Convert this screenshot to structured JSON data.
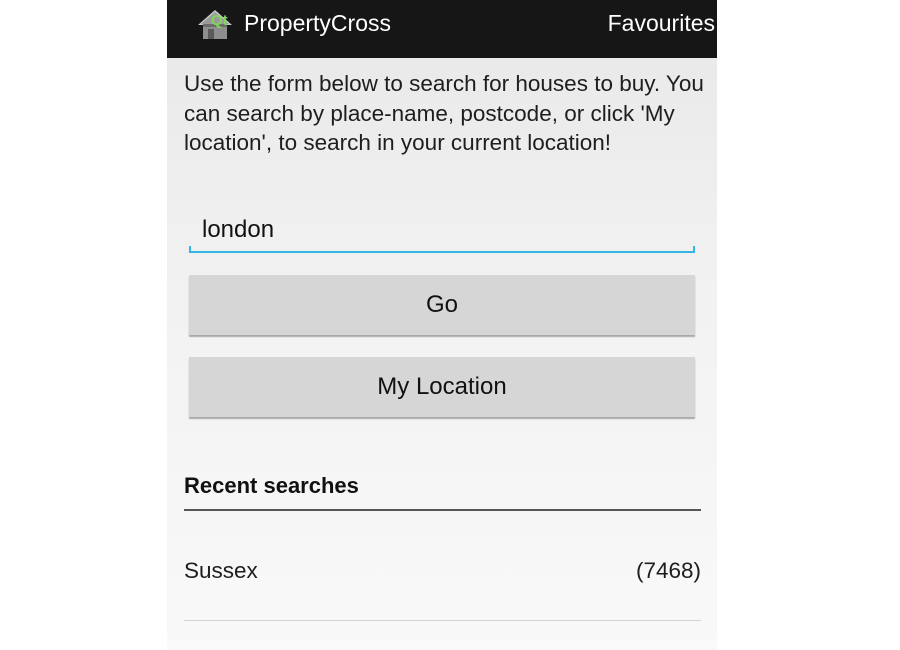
{
  "action_bar": {
    "app_icon": "house-qt-app-icon",
    "title": "PropertyCross",
    "favourites_label": "Favourites"
  },
  "intro_text": "Use the form below to search for houses to buy. You can search by place-name, postcode, or click 'My location', to search in your current location!",
  "search": {
    "value": "london",
    "placeholder": ""
  },
  "buttons": {
    "go_label": "Go",
    "my_location_label": "My Location"
  },
  "recent": {
    "header": "Recent searches",
    "items": [
      {
        "place": "Sussex",
        "count": "(7468)"
      }
    ]
  },
  "colors": {
    "action_bar_bg": "#161616",
    "accent": "#33b5e5",
    "button_bg": "#d6d6d6"
  }
}
